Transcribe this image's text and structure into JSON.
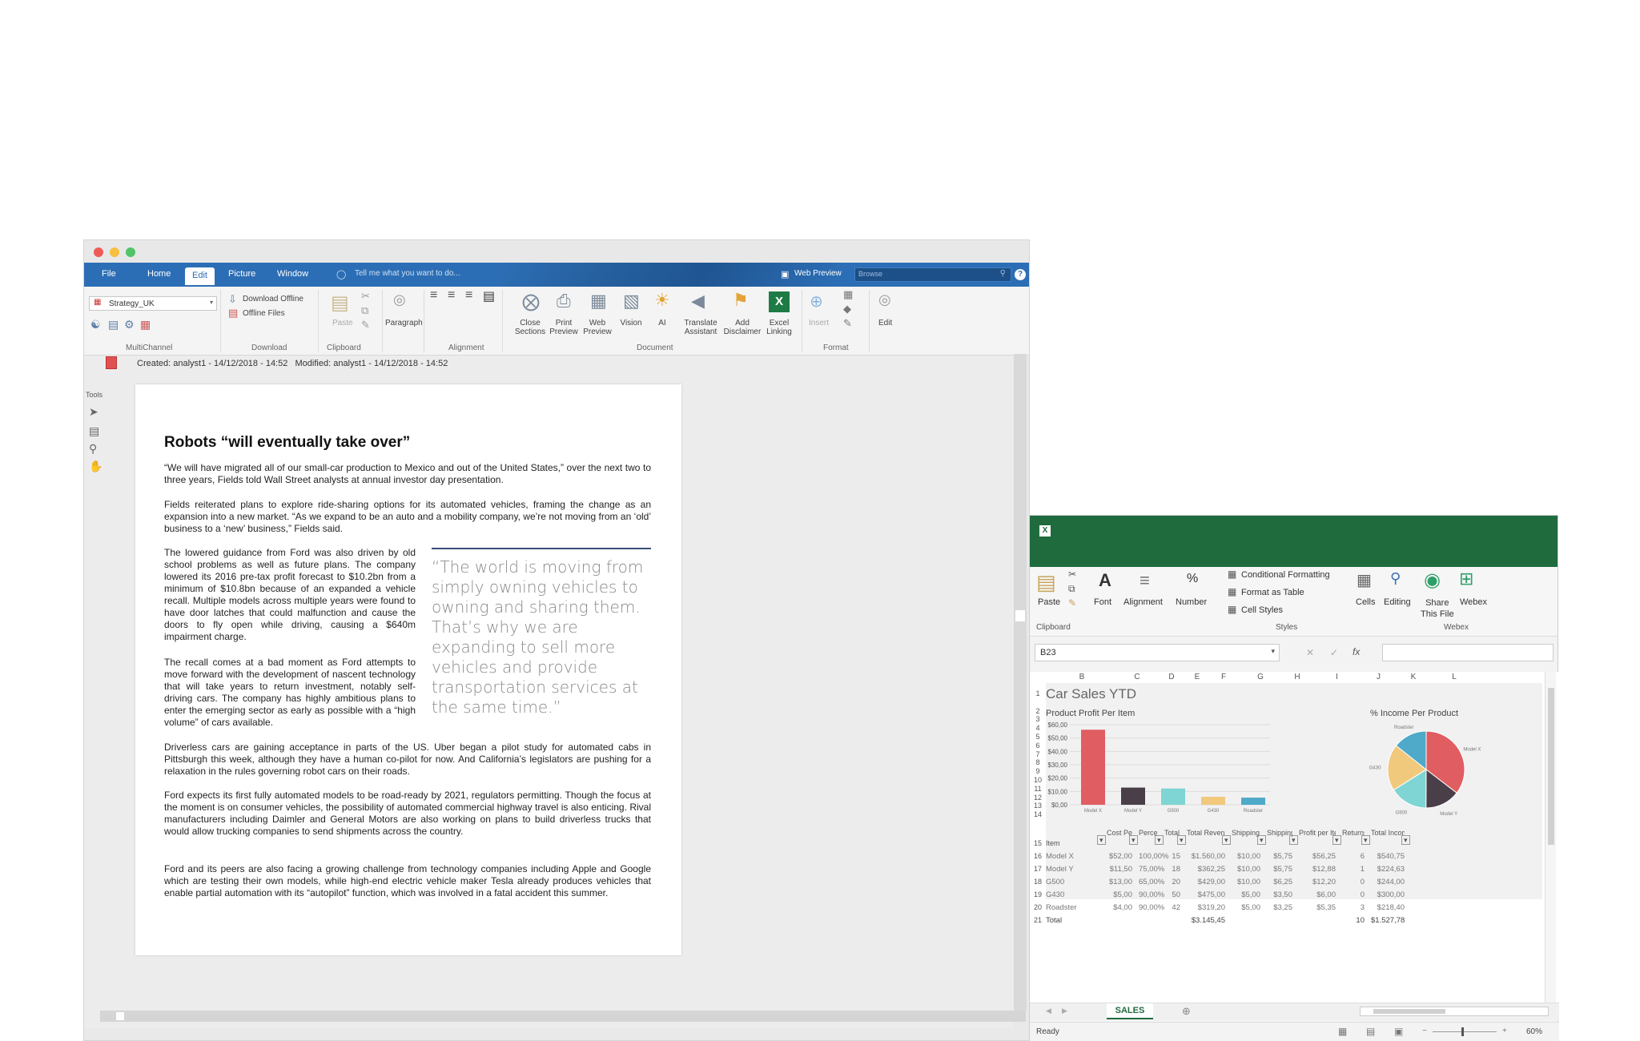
{
  "word": {
    "menu": [
      "File",
      "Home",
      "Edit",
      "Picture",
      "Window"
    ],
    "tell_me": "Tell me what you want to do...",
    "web_preview": "Web Preview",
    "browse": "Browse",
    "help": "?",
    "strategy": "Strategy_UK",
    "download_offline": "Download Offline",
    "offline_files": "Offline Files",
    "paste": "Paste",
    "paragraph": "Paragraph",
    "groups": {
      "multichannel": "MultiChannel",
      "download": "Download",
      "clipboard": "Clipboard",
      "alignment": "Alignment",
      "document": "Document",
      "format": "Format"
    },
    "doc_buttons": [
      "Close\nSections",
      "Print\nPreview",
      "Web\nPreview",
      "Vision",
      "AI",
      "Translate\nAssistant",
      "Add\nDisclaimer",
      "Excel\nLinking"
    ],
    "insert": "Insert",
    "edit": "Edit",
    "meta": "Created: analyst1 - 14/12/2018 - 14:52   Modified: analyst1 - 14/12/2018 - 14:52",
    "tools": "Tools",
    "title": "Robots “will eventually take over”",
    "p1": "“We will have migrated all of our small-car production to Mexico and out of the United States,” over the next two to three years, Fields told Wall Street analysts at annual investor day presentation.",
    "p2": "Fields reiterated plans to explore ride-sharing options for its automated vehicles, framing the change as an expansion into a new market. “As we expand to be an auto and a mobility company, we’re not moving from an ‘old’ business to a ‘new’ business,” Fields said.",
    "p3": "The lowered guidance from Ford was also driven by old school problems as well as future plans. The company lowered its 2016 pre-tax profit forecast to $10.2bn from a minimum of $10.8bn because of an expanded a vehicle recall. Multiple models across multiple years were found to have door latches that could malfunction and cause the doors to fly open while driving, causing a $640m impairment charge.",
    "p4": "The recall comes at a bad moment as Ford attempts to move forward with the development of nascent technology that will take years to return investment, notably self-driving cars. The company has highly ambitious plans to enter the emerging sector as early as possible with a “high volume” of cars available.",
    "quote": "“The world is moving from simply owning vehicles to owning and sharing them. That’s why we are expanding to sell more vehicles and provide transportation services at the same time.”",
    "p5": "Driverless cars are gaining acceptance in parts of the US. Uber began a pilot study for automated cabs in Pittsburgh this week, although they have a human co-pilot for now. And California’s legislators are pushing for a relaxation in the rules governing robot cars on their roads.",
    "p6": "Ford expects its first fully automated models to be road-ready by 2021, regulators permitting. Though the focus at the moment is on consumer vehicles, the possibility of automated commercial highway travel is also enticing. Rival manufacturers including Daimler and General Motors are also working on plans to build driverless trucks that would allow trucking companies to send shipments across the country.",
    "p7": "Ford and its peers are also facing a growing challenge from technology companies including Apple and Google which are testing their own models, while high-end electric vehicle maker Tesla already produces vehicles that enable partial automation with its “autopilot” function, which was involved in a fatal accident this summer."
  },
  "excel": {
    "ribbon": {
      "paste": "Paste",
      "font": "Font",
      "alignment": "Alignment",
      "number": "Number",
      "cond": "Conditional Formatting",
      "table": "Format as Table",
      "cellstyles": "Cell Styles",
      "cells": "Cells",
      "editing": "Editing",
      "share": "Share\nThis File",
      "webex": "Webex",
      "clipboard": "Clipboard",
      "styles": "Styles",
      "webex_group": "Webex"
    },
    "namebox": "B23",
    "cols": [
      "B",
      "C",
      "D",
      "E",
      "F",
      "G",
      "H",
      "I",
      "J",
      "K",
      "L"
    ],
    "title": "Car Sales YTD",
    "chart1_title": "Product Profit Per Item",
    "chart2_title": "% Income Per Product",
    "headers": [
      "Item",
      "Cost Per Item",
      "Percent Markup",
      "Total Sold",
      "Total Revenue",
      "Shipping Charge/Item",
      "Shipping Cost/Item",
      "Profit per Item (incl. shipping)",
      "Returns",
      "Total Income"
    ],
    "rows": [
      [
        "Model X",
        "$52,00",
        "100,00%",
        "15",
        "$1.560,00",
        "$10,00",
        "$5,75",
        "$56,25",
        "6",
        "$540,75"
      ],
      [
        "Model Y",
        "$11,50",
        "75,00%",
        "18",
        "$362,25",
        "$10,00",
        "$5,75",
        "$12,88",
        "1",
        "$224,63"
      ],
      [
        "G500",
        "$13,00",
        "65,00%",
        "20",
        "$429,00",
        "$10,00",
        "$6,25",
        "$12,20",
        "0",
        "$244,00"
      ],
      [
        "G430",
        "$5,00",
        "90,00%",
        "50",
        "$475,00",
        "$5,00",
        "$3,50",
        "$6,00",
        "0",
        "$300,00"
      ],
      [
        "Roadster",
        "$4,00",
        "90,00%",
        "42",
        "$319,20",
        "$5,00",
        "$3,25",
        "$5,35",
        "3",
        "$218,40"
      ]
    ],
    "total_label": "Total",
    "total_revenue": "$3.145,45",
    "total_returns": "10",
    "total_income": "$1.527,78",
    "sheet": "SALES",
    "ready": "Ready",
    "zoom": "60%"
  },
  "chart_data": [
    {
      "type": "bar",
      "title": "Product Profit Per Item",
      "categories": [
        "Model X",
        "Model Y",
        "G500",
        "G430",
        "Roadster"
      ],
      "values": [
        56.25,
        12.88,
        12.2,
        6.0,
        5.35
      ],
      "ylim": [
        0,
        60
      ],
      "yticks": [
        "$0,00",
        "$10,00",
        "$20,00",
        "$30,00",
        "$40,00",
        "$50,00",
        "$60,00"
      ],
      "colors": [
        "#e05d62",
        "#4a3e49",
        "#7fd5d3",
        "#f1c97d",
        "#4fa9c9"
      ]
    },
    {
      "type": "pie",
      "title": "% Income Per Product",
      "categories": [
        "Model X",
        "Model Y",
        "G500",
        "G430",
        "Roadster"
      ],
      "values": [
        540.75,
        224.63,
        244.0,
        300.0,
        218.4
      ],
      "colors": [
        "#e05d62",
        "#4a3e49",
        "#7fd5d3",
        "#f1c97d",
        "#4fa9c9"
      ]
    }
  ]
}
